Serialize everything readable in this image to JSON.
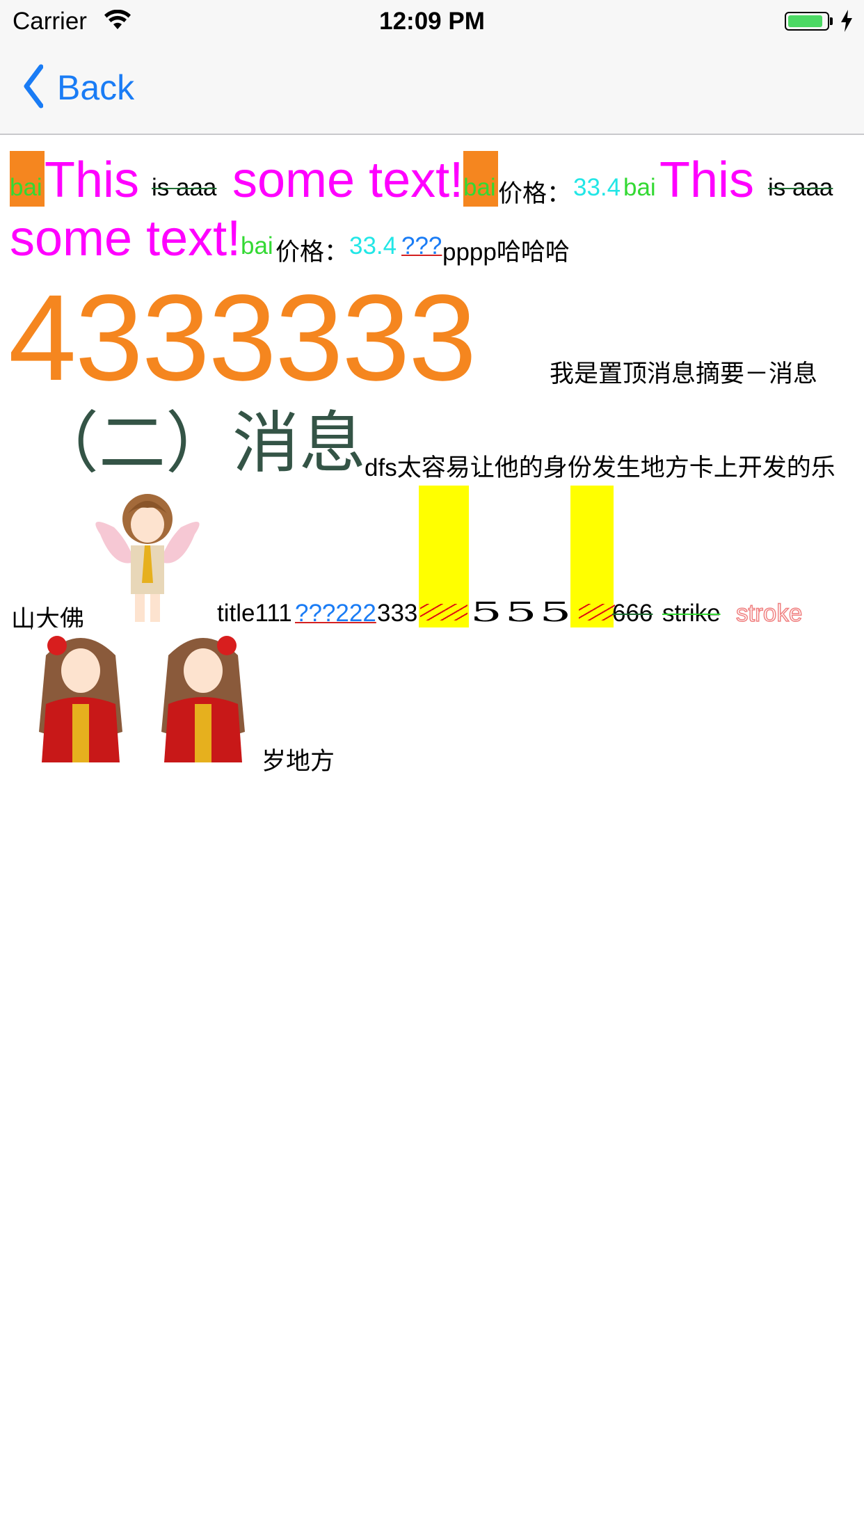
{
  "status_bar": {
    "carrier": "Carrier",
    "time": "12:09 PM",
    "battery_level": 0.9,
    "battery_color": "#4cd964"
  },
  "nav": {
    "back_label": "Back",
    "accent_color": "#1a7cf5"
  },
  "content": {
    "line1": {
      "bai1": "bai",
      "this1": "This",
      "is_aaa1": "is aaa",
      "some_text1": "some text!",
      "bai2": "bai",
      "price_label1": "价格：",
      "price1": "33.4",
      "bai3": "bai",
      "this2": "This",
      "is_aaa2": "is aaa"
    },
    "line2": {
      "some_text2": "some text!",
      "bai4": "bai",
      "price_label2": "价格：",
      "price2": "33.4",
      "link_q": "???",
      "tail": "pppp哈哈哈"
    },
    "line3": {
      "big_number": "4333333",
      "summary": "我是置顶消息摘要－消息"
    },
    "line4": {
      "heading": "（二）消息",
      "desc": "dfs太容易让他的身份发生地方卡上开发的乐"
    },
    "line5": {
      "shan": "山大佛",
      "title": "title111",
      "link_q2": "???222",
      "num333": "333",
      "num555": "555",
      "num666": "666",
      "strike": "strike",
      "stroke": "stroke"
    },
    "line6": {
      "tail": "岁地方"
    },
    "colors": {
      "magenta": "#ff00ff",
      "green": "#33d933",
      "cyan": "#22e6e6",
      "orange": "#f5861f",
      "dark_green": "#345446",
      "yellow": "#ffff00"
    }
  }
}
